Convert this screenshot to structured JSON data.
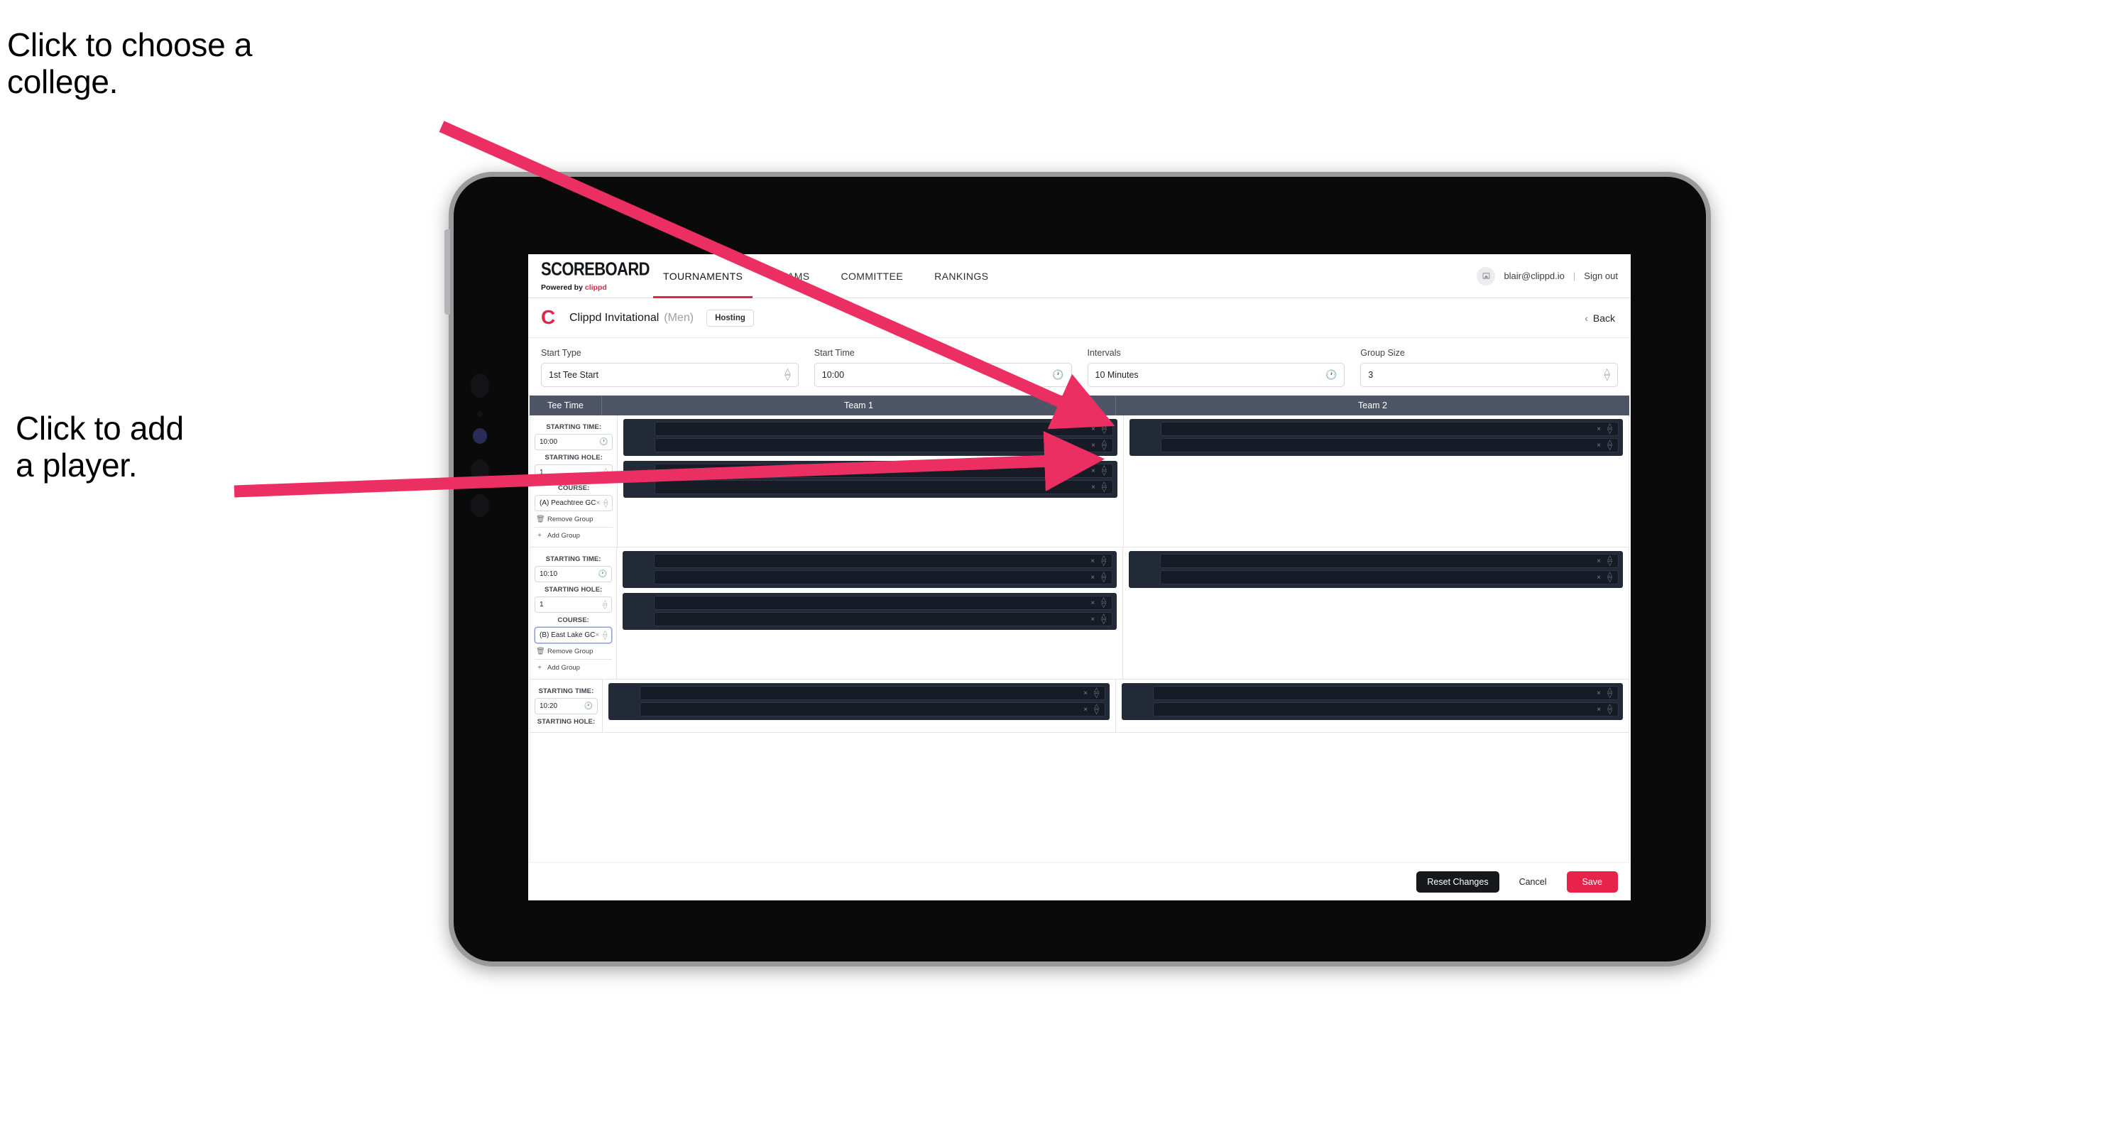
{
  "annotations": [
    {
      "id": "college",
      "text": "Click to choose a\ncollege."
    },
    {
      "id": "player",
      "text": "Click to add\na player."
    }
  ],
  "arrow_color": "#ec2f63",
  "brand": {
    "title": "SCOREBOARD",
    "powered_prefix": "Powered by ",
    "powered_name": "clippd"
  },
  "nav": {
    "tabs": [
      {
        "label": "TOURNAMENTS",
        "active": true
      },
      {
        "label": "TEAMS",
        "active": false
      },
      {
        "label": "COMMITTEE",
        "active": false
      },
      {
        "label": "RANKINGS",
        "active": false
      }
    ],
    "avatar_icon": "user-avatar-icon",
    "email": "blair@clippd.io",
    "separator": "|",
    "sign_out": "Sign out"
  },
  "tournament": {
    "logo_glyph": "C",
    "name": "Clippd Invitational",
    "gender": "(Men)",
    "badge": "Hosting",
    "back_chevron": "‹",
    "back_label": "Back"
  },
  "controls": [
    {
      "label": "Start Type",
      "value": "1st Tee Start",
      "icon": "stepper-icon"
    },
    {
      "label": "Start Time",
      "value": "10:00",
      "icon": "clock-icon"
    },
    {
      "label": "Intervals",
      "value": "10 Minutes",
      "icon": "clock-icon"
    },
    {
      "label": "Group Size",
      "value": "3",
      "icon": "stepper-icon"
    }
  ],
  "table": {
    "headers": [
      "Tee Time",
      "Team 1",
      "Team 2"
    ],
    "labels": {
      "starting_time": "STARTING TIME:",
      "starting_hole": "STARTING HOLE:",
      "course": "COURSE:",
      "remove_group": "Remove Group",
      "add_group": "Add Group",
      "remove_icon": "trash-icon",
      "add_icon": "plus-icon",
      "clock_icon": "clock-icon",
      "stepper_icon": "stepper-icon",
      "clear_icon": "clear-x-icon"
    },
    "groups": [
      {
        "starting_time": "10:00",
        "starting_hole": "1",
        "course": "(A) Peachtree GC",
        "course_focused": false,
        "team1": [
          {
            "players": [
              "",
              ""
            ]
          },
          {
            "players": [
              "",
              ""
            ]
          }
        ],
        "team2": [
          {
            "players": [
              "",
              ""
            ]
          }
        ]
      },
      {
        "starting_time": "10:10",
        "starting_hole": "1",
        "course": "(B) East Lake GC",
        "course_focused": true,
        "team1": [
          {
            "players": [
              "",
              ""
            ]
          },
          {
            "players": [
              "",
              ""
            ]
          }
        ],
        "team2": [
          {
            "players": [
              "",
              ""
            ]
          }
        ]
      },
      {
        "starting_time": "10:20",
        "starting_hole": "",
        "course": "",
        "course_focused": false,
        "team1": [
          {
            "players": [
              "",
              ""
            ]
          }
        ],
        "team2": [
          {
            "players": [
              "",
              ""
            ]
          }
        ]
      }
    ]
  },
  "footer": {
    "reset": "Reset Changes",
    "cancel": "Cancel",
    "save": "Save"
  }
}
